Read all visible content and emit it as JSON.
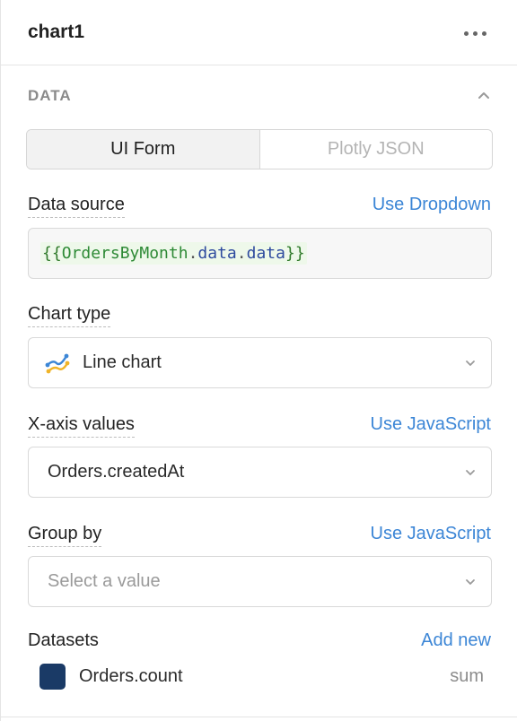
{
  "header": {
    "title": "chart1",
    "more_icon": "ellipsis-icon"
  },
  "section": {
    "title": "DATA",
    "collapse_icon": "chevron-up-icon"
  },
  "mode_toggle": {
    "options": [
      "UI Form",
      "Plotly JSON"
    ],
    "selected": "UI Form"
  },
  "data_source": {
    "label": "Data source",
    "link": "Use Dropdown",
    "value": "{{OrdersByMonth.data.data}}",
    "tokens": {
      "open": "{{",
      "var": "OrdersByMonth",
      "dot1": ".",
      "prop1": "data",
      "dot2": ".",
      "prop2": "data",
      "close": "}}"
    }
  },
  "chart_type": {
    "label": "Chart type",
    "value": "Line chart",
    "icon": "line-chart-icon"
  },
  "x_axis": {
    "label": "X-axis values",
    "link": "Use JavaScript",
    "value": "Orders.createdAt"
  },
  "group_by": {
    "label": "Group by",
    "link": "Use JavaScript",
    "placeholder": "Select a value"
  },
  "datasets": {
    "label": "Datasets",
    "link": "Add new",
    "items": [
      {
        "name": "Orders.count",
        "aggregation": "sum",
        "color": "#1a3a66"
      }
    ]
  },
  "colors": {
    "accent": "#3c86d6",
    "muted": "#8a8a8a"
  }
}
